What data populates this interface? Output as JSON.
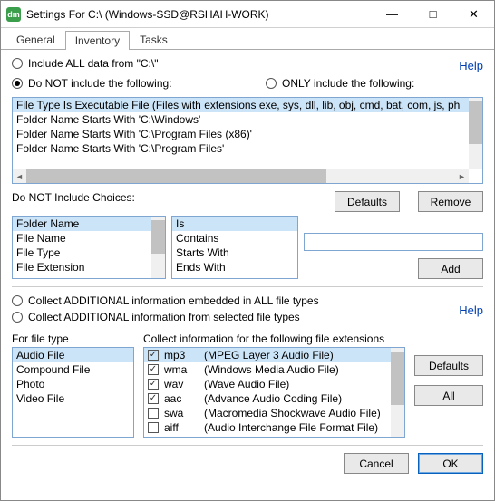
{
  "window": {
    "icon_text": "dm",
    "title": "Settings For C:\\ (Windows-SSD@RSHAH-WORK)"
  },
  "tabs": {
    "general": "General",
    "inventory": "Inventory",
    "tasks": "Tasks"
  },
  "help": "Help",
  "radios": {
    "include_all": "Include ALL data from \"C:\\\"",
    "do_not_include": "Do NOT include the following:",
    "only_include": "ONLY include the following:"
  },
  "filters": {
    "items": [
      "File Type Is Executable File (Files with extensions exe, sys, dll, lib, obj, cmd, bat, com, js, ph",
      "Folder Name Starts With 'C:\\Windows'",
      "Folder Name Starts With 'C:\\Program Files (x86)'",
      "Folder Name Starts With 'C:\\Program Files'",
      ""
    ]
  },
  "choices": {
    "label": "Do NOT Include Choices:",
    "col1": [
      "Folder Name",
      "File Name",
      "File Type",
      "File Extension"
    ],
    "col2": [
      "Is",
      "Contains",
      "Starts With",
      "Ends With"
    ]
  },
  "buttons": {
    "defaults": "Defaults",
    "remove": "Remove",
    "add": "Add",
    "all": "All",
    "cancel": "Cancel",
    "ok": "OK"
  },
  "collect": {
    "all": "Collect ADDITIONAL information embedded in ALL file types",
    "sel": "Collect ADDITIONAL information from selected file types"
  },
  "filetype": {
    "label": "For file type",
    "items": [
      "Audio File",
      "Compound File",
      "Photo",
      "Video File"
    ]
  },
  "extensions": {
    "label": "Collect information for the following file extensions",
    "rows": [
      {
        "checked": true,
        "ext": "mp3",
        "desc": "(MPEG Layer 3 Audio File)"
      },
      {
        "checked": true,
        "ext": "wma",
        "desc": "(Windows Media Audio File)"
      },
      {
        "checked": true,
        "ext": "wav",
        "desc": "(Wave Audio File)"
      },
      {
        "checked": true,
        "ext": "aac",
        "desc": "(Advance Audio Coding File)"
      },
      {
        "checked": false,
        "ext": "swa",
        "desc": "(Macromedia Shockwave Audio File)"
      },
      {
        "checked": false,
        "ext": "aiff",
        "desc": "(Audio Interchange File Format File)"
      }
    ]
  }
}
